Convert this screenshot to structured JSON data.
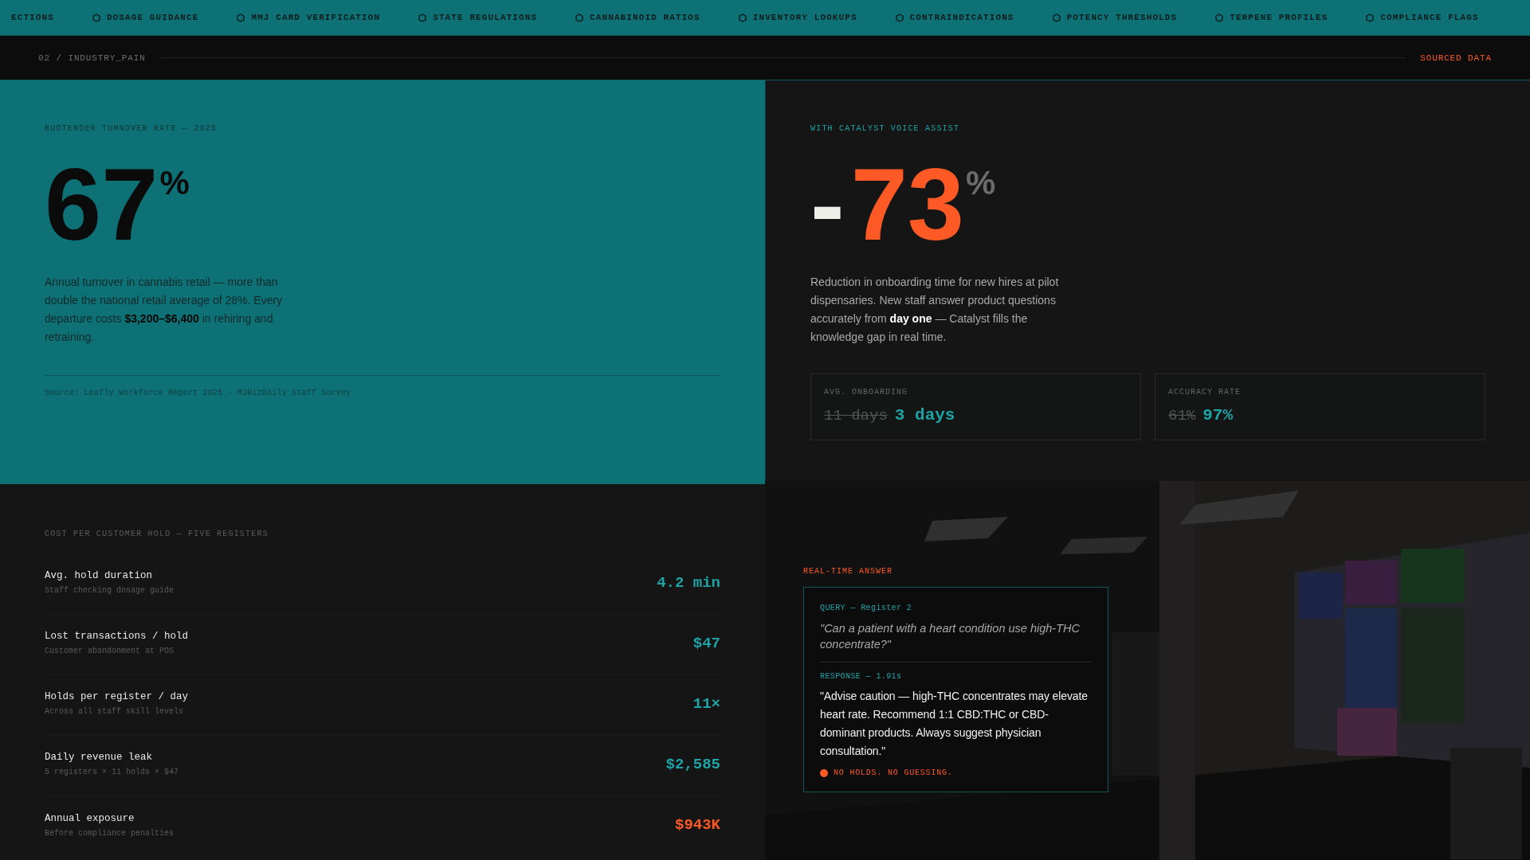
{
  "ticker": {
    "items": [
      "ECTIONS",
      "DOSAGE GUIDANCE",
      "MMJ CARD VERIFICATION",
      "STATE REGULATIONS",
      "CANNABINOID RATIOS",
      "INVENTORY LOOKUPS",
      "CONTRAINDICATIONS",
      "POTENCY THRESHOLDS",
      "TERPENE PROFILES",
      "COMPLIANCE FLAGS"
    ]
  },
  "section_header": {
    "label": "02 / INDUSTRY_PAIN",
    "badge": "SOURCED DATA"
  },
  "turnover": {
    "label": "BUDTENDER TURNOVER RATE — 2025",
    "value": "67",
    "unit": "%",
    "description": "Annual turnover in cannabis retail — more than double the national retail average of 28%. Every departure costs **$3,200–$6,400** in rehiring and retraining.",
    "source": "Source: Leafly Workforce Report 2025 · MJBizDaily Staff Survey"
  },
  "catalyst": {
    "label": "WITH CATALYST VOICE ASSIST",
    "sign": "-",
    "value": "73",
    "unit": "%",
    "description": "Reduction in onboarding time for new hires at pilot dispensaries. New staff answer product questions accurately from **day one** — Catalyst fills the knowledge gap in real time.",
    "stats": [
      {
        "label": "AVG. ONBOARDING",
        "before": "11 days",
        "after": "3 days"
      },
      {
        "label": "ACCURACY RATE",
        "before": "61%",
        "after": "97%"
      }
    ]
  },
  "cost": {
    "title": "COST PER CUSTOMER HOLD — FIVE REGISTERS",
    "rows": [
      {
        "label": "Avg. hold duration",
        "note": "Staff checking dosage guide",
        "value": "4.2 min",
        "color": "#1fa3a6"
      },
      {
        "label": "Lost transactions / hold",
        "note": "Customer abandonment at POS",
        "value": "$47",
        "color": "#1fa3a6"
      },
      {
        "label": "Holds per register / day",
        "note": "Across all staff skill levels",
        "value": "11×",
        "color": "#1fa3a6"
      },
      {
        "label": "Daily revenue leak",
        "note": "5 registers × 11 holds × $47",
        "value": "$2,585",
        "color": "#1fa3a6"
      },
      {
        "label": "Annual exposure",
        "note": "Before compliance penalties",
        "value": "$943K",
        "color": "#ff5a26"
      }
    ]
  },
  "answer": {
    "label": "REAL-TIME ANSWER",
    "query_label": "QUERY — Register 2",
    "query": "\"Can a patient with a heart condition use high-THC concentrate?\"",
    "response_label": "RESPONSE — 1.91s",
    "response": "\"Advise caution — high-THC concentrates may elevate heart rate. Recommend 1:1 CBD:THC or CBD-dominant products. Always suggest physician consultation.\"",
    "status": "NO HOLDS. NO GUESSING."
  }
}
